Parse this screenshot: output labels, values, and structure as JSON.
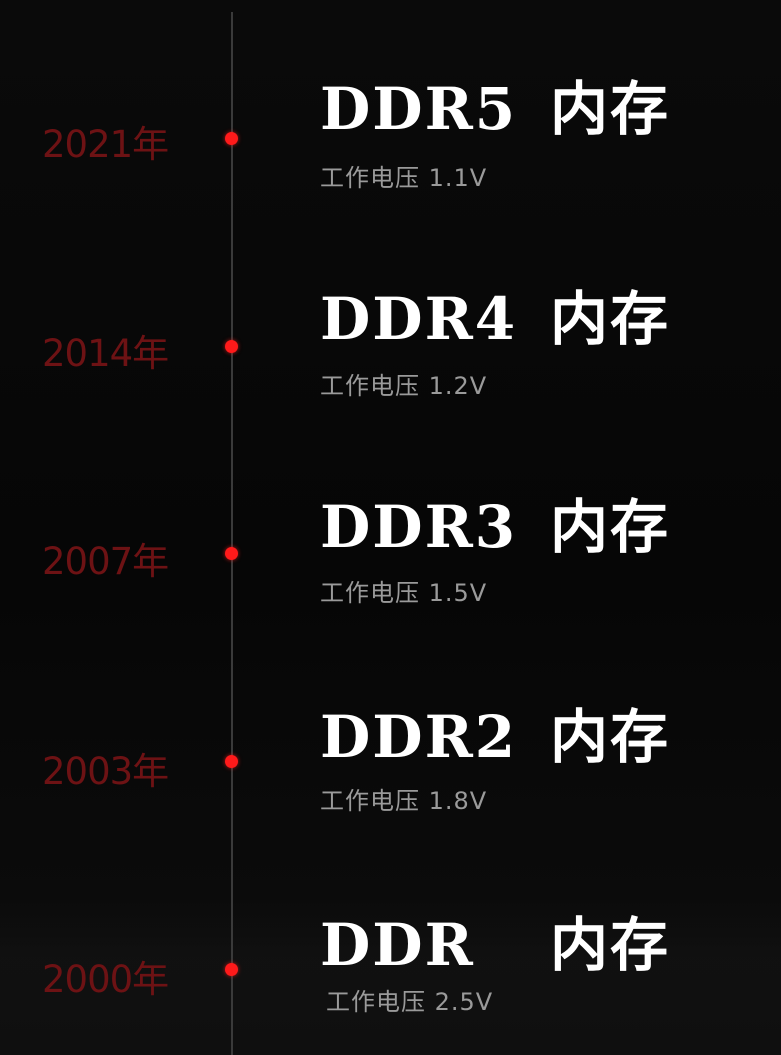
{
  "timeline": {
    "entries": [
      {
        "year": "2021年",
        "model": "DDR5",
        "kind": "内存",
        "voltage": "工作电压 1.1V"
      },
      {
        "year": "2014年",
        "model": "DDR4",
        "kind": "内存",
        "voltage": "工作电压 1.2V"
      },
      {
        "year": "2007年",
        "model": "DDR3",
        "kind": "内存",
        "voltage": "工作电压 1.5V"
      },
      {
        "year": "2003年",
        "model": "DDR2",
        "kind": "内存",
        "voltage": "工作电压 1.8V"
      },
      {
        "year": "2000年",
        "model": "DDR",
        "kind": "内存",
        "voltage": "工作电压 2.5V"
      }
    ]
  },
  "colors": {
    "background": "#050505",
    "year_text": "#6d1214",
    "dot": "#ff1a1a",
    "line": "#3a3a3a",
    "title": "#ffffff",
    "voltage": "#9a9a9a"
  }
}
